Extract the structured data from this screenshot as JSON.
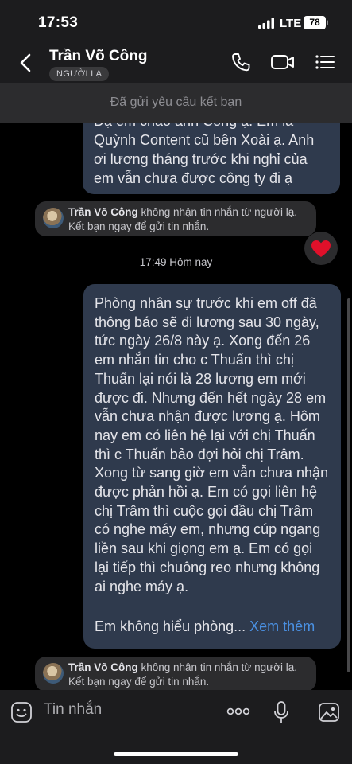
{
  "status": {
    "time": "17:53",
    "network": "LTE",
    "battery": "78"
  },
  "header": {
    "contact_name": "Trần Võ Công",
    "badge": "NGƯỜI LẠ",
    "icons": [
      "back-chevron-icon",
      "phone-icon",
      "video-icon",
      "menu-icon"
    ]
  },
  "friend_request": {
    "text": "Đã gửi yêu cầu kết bạn"
  },
  "messages": [
    {
      "text": "Dạ em chào anh Công ạ. Em là Quỳnh Content cũ bên Xoài ạ. Anh ơi lương tháng trước khi nghỉ của em vẫn chưa được công ty đi ạ"
    },
    {
      "text": "Phòng nhân sự trước khi em off đã thông báo sẽ đi lương sau 30 ngày, tức ngày 26/8 này ạ. Xong đến 26 em nhắn tin cho c Thuấn thì chị Thuấn lại nói là 28 lương em mới được đi. Nhưng đến hết ngày 28 em vẫn chưa nhận được lương ạ. Hôm nay em có liên hệ lại với chị Thuấn thì c Thuấn bảo đợi hỏi chị Trâm. Xong từ sang giờ em vẫn chưa nhận được phản hồi ạ. Em có gọi liên hệ chị Trâm thì cuộc gọi đầu chị Trâm có nghe máy em, nhưng cúp ngang liền sau khi giọng em ạ. Em có gọi lại tiếp thì chuông reo nhưng không ai nghe máy ạ.",
      "truncated": "Em không hiểu phòng...",
      "see_more": "Xem thêm"
    }
  ],
  "notice": {
    "name": "Trần Võ Công",
    "text_line1": " không nhận tin nhắn từ người lạ.",
    "text_line2": "Kết bạn ngay để gửi tin nhắn."
  },
  "timestamp": "17:49 Hôm nay",
  "reaction": {
    "icon": "heart-icon",
    "color": "#e0102a"
  },
  "input": {
    "placeholder": "Tin nhắn"
  },
  "colors": {
    "bubble": "#2f3a4d",
    "accent": "#4a90e2",
    "background": "#000000"
  }
}
